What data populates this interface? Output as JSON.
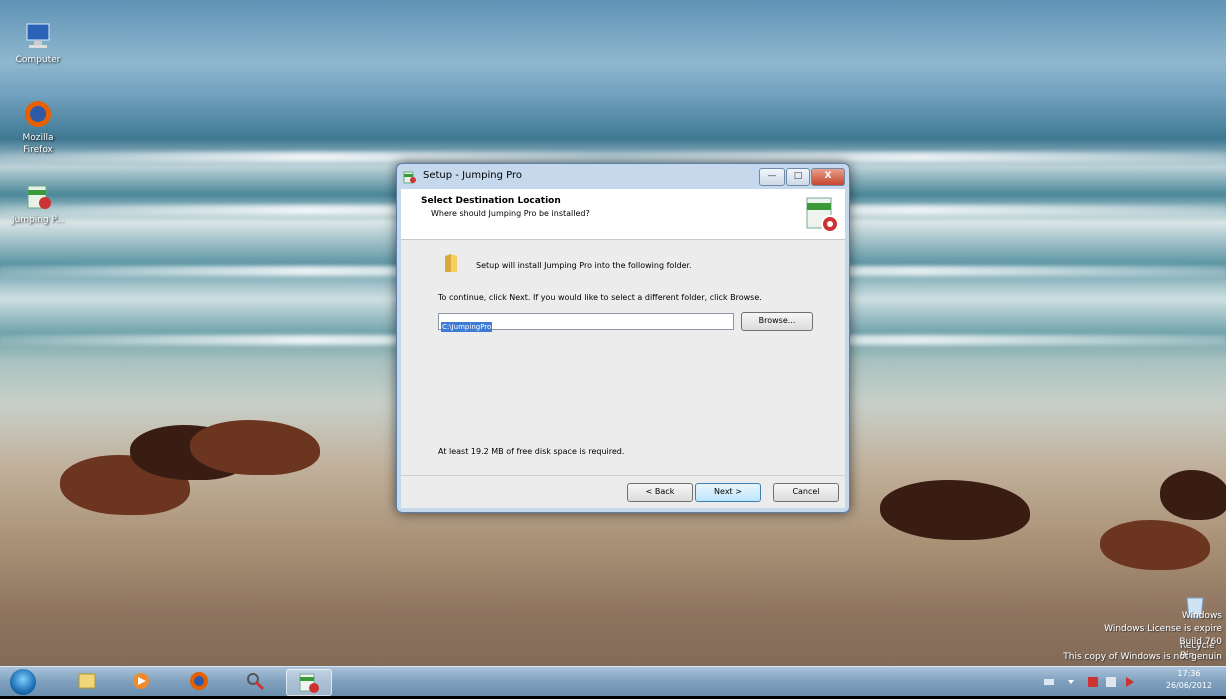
{
  "desktop": {
    "icons": [
      {
        "label": "Computer",
        "icon": "computer-icon"
      },
      {
        "label": "Mozilla Firefox",
        "icon": "firefox-icon"
      },
      {
        "label": "Jumping P...",
        "icon": "installer-icon"
      }
    ],
    "recycle_bin_label": "Recycle Bin",
    "watermark": {
      "line1": "Windows",
      "line2": "Windows License is expire",
      "line3": "Build 760",
      "line4": "This copy of Windows is not genuin"
    }
  },
  "dialog": {
    "title": "Setup - Jumping Pro",
    "controls": {
      "minimize": "—",
      "maximize": "□",
      "close": "X"
    },
    "header_title": "Select Destination Location",
    "header_subtitle": "Where should Jumping Pro be installed?",
    "install_message": "Setup will install Jumping Pro into the following folder.",
    "continue_message": "To continue, click Next. If you would like to select a different folder, click Browse.",
    "path_value": "C:\\JumpingPro",
    "browse_label": "Browse...",
    "disk_space": "At least 19.2 MB of free disk space is required.",
    "back_label": "< Back",
    "next_label": "Next >",
    "cancel_label": "Cancel"
  },
  "taskbar": {
    "clock_time": "17:36",
    "clock_date": "26/06/2012",
    "items": [
      "explorer-icon",
      "media-player-icon",
      "firefox-icon",
      "tools-icon",
      "installer-icon"
    ]
  }
}
